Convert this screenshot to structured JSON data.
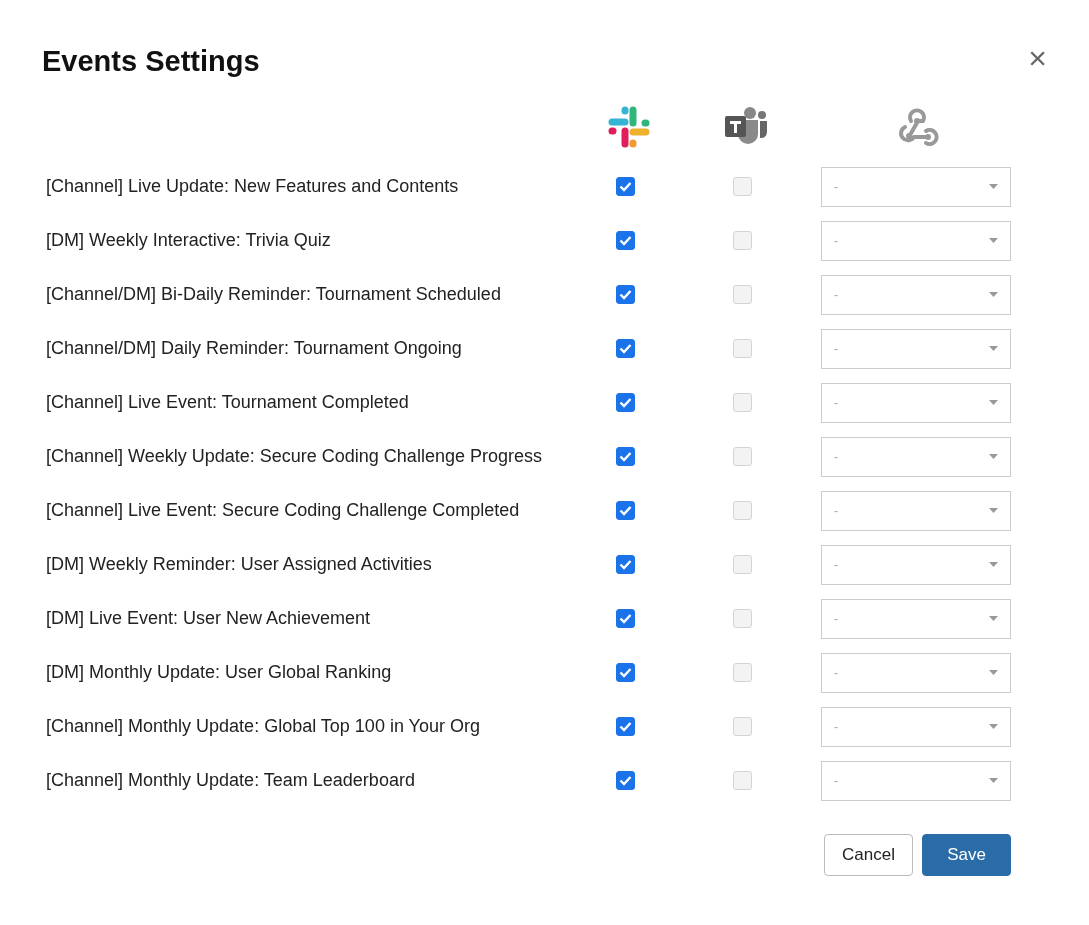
{
  "dialog": {
    "title": "Events Settings",
    "close": "×"
  },
  "events": [
    {
      "label": "[Channel] Live Update: New Features and Contents",
      "slack": {
        "checked": true
      },
      "teams": {
        "checked": false,
        "disabled": true
      },
      "webhook": {
        "value": "-"
      }
    },
    {
      "label": "[DM] Weekly Interactive: Trivia Quiz",
      "slack": {
        "checked": true
      },
      "teams": {
        "checked": false,
        "disabled": true
      },
      "webhook": {
        "value": "-"
      }
    },
    {
      "label": "[Channel/DM] Bi-Daily Reminder: Tournament Scheduled",
      "slack": {
        "checked": true
      },
      "teams": {
        "checked": false,
        "disabled": true
      },
      "webhook": {
        "value": "-"
      }
    },
    {
      "label": "[Channel/DM] Daily Reminder: Tournament Ongoing",
      "slack": {
        "checked": true
      },
      "teams": {
        "checked": false,
        "disabled": true
      },
      "webhook": {
        "value": "-"
      }
    },
    {
      "label": "[Channel] Live Event: Tournament Completed",
      "slack": {
        "checked": true
      },
      "teams": {
        "checked": false,
        "disabled": true
      },
      "webhook": {
        "value": "-"
      }
    },
    {
      "label": "[Channel] Weekly Update: Secure Coding Challenge Progress",
      "slack": {
        "checked": true
      },
      "teams": {
        "checked": false,
        "disabled": true
      },
      "webhook": {
        "value": "-"
      }
    },
    {
      "label": "[Channel] Live Event: Secure Coding Challenge Completed",
      "slack": {
        "checked": true
      },
      "teams": {
        "checked": false,
        "disabled": true
      },
      "webhook": {
        "value": "-"
      }
    },
    {
      "label": "[DM] Weekly Reminder: User Assigned Activities",
      "slack": {
        "checked": true
      },
      "teams": {
        "checked": false,
        "disabled": true
      },
      "webhook": {
        "value": "-"
      }
    },
    {
      "label": "[DM] Live Event: User New Achievement",
      "slack": {
        "checked": true
      },
      "teams": {
        "checked": false,
        "disabled": true
      },
      "webhook": {
        "value": "-"
      }
    },
    {
      "label": "[DM] Monthly Update: User Global Ranking",
      "slack": {
        "checked": true
      },
      "teams": {
        "checked": false,
        "disabled": true
      },
      "webhook": {
        "value": "-"
      }
    },
    {
      "label": "[Channel] Monthly Update: Global Top 100 in Your Org",
      "slack": {
        "checked": true
      },
      "teams": {
        "checked": false,
        "disabled": true
      },
      "webhook": {
        "value": "-"
      }
    },
    {
      "label": "[Channel] Monthly Update: Team Leaderboard",
      "slack": {
        "checked": true
      },
      "teams": {
        "checked": false,
        "disabled": true
      },
      "webhook": {
        "value": "-"
      }
    }
  ],
  "buttons": [
    {
      "label": "Cancel",
      "kind": "secondary"
    },
    {
      "label": "Save",
      "kind": "primary"
    }
  ]
}
